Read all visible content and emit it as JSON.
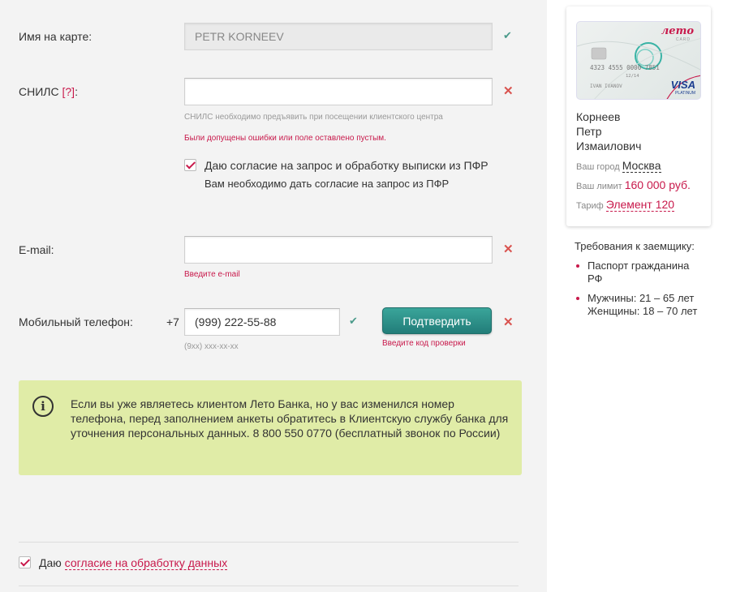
{
  "form": {
    "card_name_label": "Имя на карте:",
    "card_name_value": "PETR KORNEEV",
    "snils_label": "СНИЛС",
    "snils_help": "[?]",
    "snils_hint": "СНИЛС необходимо предъявить при посещении клиентского центра",
    "snils_error": "Были допущены ошибки или поле оставлено пустым.",
    "pfr_consent": "Даю согласие на запрос и обработку выписки из ПФР",
    "pfr_note": "Вам необходимо дать согласие на запрос из ПФР",
    "email_label": "E-mail:",
    "email_error": "Введите e-mail",
    "phone_label": "Мобильный телефон:",
    "phone_prefix": "+7",
    "phone_value": "(999) 222-55-88",
    "phone_hint": "(9xx) xxx-xx-xx",
    "confirm_button": "Подтвердить",
    "confirm_error": "Введите код проверки",
    "notice_icon": "i",
    "notice_text": "Если вы уже являетесь клиентом Лето Банка, но у вас изменился номер телефона, перед заполнением анкеты обратитесь в Клиентскую службу банка для уточнения персональных данных. 8 800 550 0770 (бесплатный звонок по России)",
    "agree_prefix": "Даю",
    "agree_link": "согласие на обработку данных"
  },
  "sidebar": {
    "card": {
      "brand": "лето",
      "brand_sub": "CARD",
      "number": "4323 4555 0000 7851",
      "valid": "12/14",
      "holder": "IVAN IVANOV",
      "network": "VISA",
      "network_sub": "PLATINUM"
    },
    "surname": "Корнеев",
    "first_name": "Петр",
    "patronymic": "Измаилович",
    "city_label": "Ваш город",
    "city_value": "Москва",
    "limit_label": "Ваш лимит",
    "limit_value": "160 000 руб.",
    "tariff_label": "Тариф",
    "tariff_value": "Элемент 120",
    "req_title": "Требования к заемщику:",
    "req_items": [
      "Паспорт гражданина РФ",
      "Мужчины: 21 – 65 лет Женщины: 18 – 70 лет"
    ]
  },
  "icons": {
    "ok": "check-icon",
    "error": "close-icon",
    "info": "info-icon",
    "checkbox": "checkbox-checked"
  },
  "colors": {
    "accent": "#c8194b",
    "button": "#2a8c86",
    "notice_bg": "#e0eca7",
    "ok": "#4a9a8a"
  }
}
